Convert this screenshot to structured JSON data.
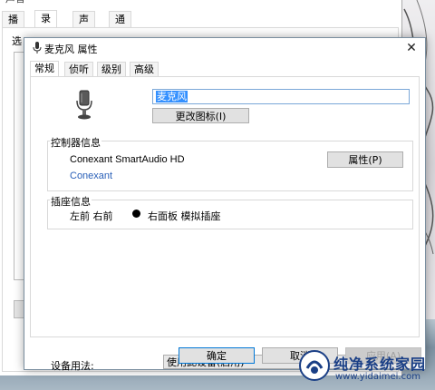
{
  "back_window": {
    "title": "声音",
    "tabs": [
      "播放",
      "录制",
      "声音",
      "通信"
    ],
    "active_tab": "录制",
    "side_label": "选"
  },
  "dialog": {
    "title": "麦克风 属性",
    "tabs": [
      "常规",
      "侦听",
      "级别",
      "高级"
    ],
    "active_tab": "常规",
    "device_name": "麦克风",
    "change_icon_button": "更改图标(I)",
    "controller_group_label": "控制器信息",
    "controller_name": "Conexant SmartAudio HD",
    "controller_vendor_link": "Conexant",
    "properties_button": "属性(P)",
    "jack_group_label": "插座信息",
    "jack_location": "左前 右前",
    "jack_description": "右面板 模拟插座",
    "jack_color": "#000000",
    "device_usage_label": "设备用法:",
    "device_usage_value": "使用此设备(启用)",
    "ok_button": "确定",
    "cancel_button": "取消",
    "apply_button": "应用(A)"
  },
  "watermark": {
    "brand": "纯净系统家园",
    "url": "www.yidaimei.com"
  },
  "colors": {
    "link": "#2a60b8",
    "selection": "#3390ff",
    "focus_border": "#0078d7",
    "watermark": "#1a3f86"
  }
}
